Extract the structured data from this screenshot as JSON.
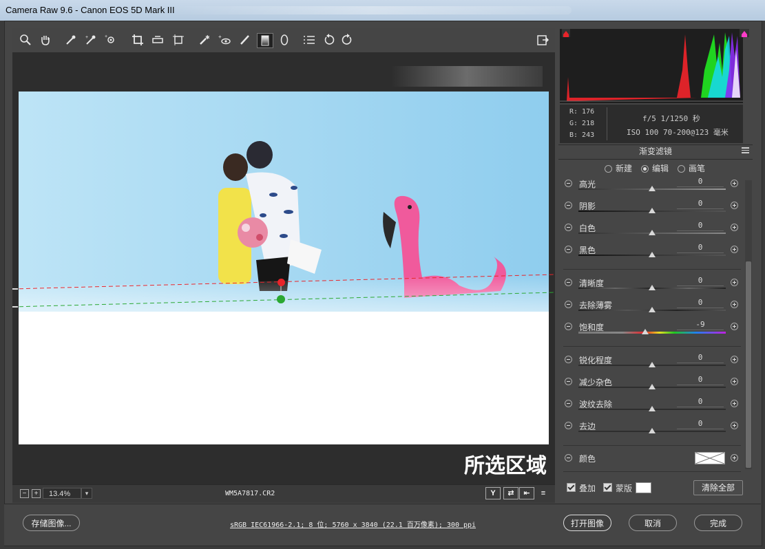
{
  "window": {
    "title": "Camera Raw 9.6 -  Canon EOS 5D Mark III"
  },
  "toolbar": {
    "tools": [
      "zoom-icon",
      "hand-icon",
      "white-balance-icon",
      "color-sampler-icon",
      "targeted-adjust-icon",
      "crop-icon",
      "straighten-icon",
      "transform-icon",
      "spot-removal-icon",
      "red-eye-icon",
      "adjustment-brush-icon",
      "graduated-filter-icon",
      "radial-filter-icon",
      "preferences-icon",
      "rotate-left-icon",
      "rotate-right-icon"
    ],
    "fullscreen": "fullscreen-icon"
  },
  "canvas": {
    "overlay_label": "所选区域",
    "zoom": "13.4%",
    "zoom_minus": "−",
    "zoom_plus": "+",
    "filename": "WM5A7817.CR2",
    "view_buttons": [
      "Y",
      "⇄",
      "⇤",
      "≡"
    ]
  },
  "info": {
    "r": "R:  176",
    "g": "G:  218",
    "b": "B:  243",
    "aperture_shutter": "f/5  1/1250 秒",
    "iso_lens": "ISO 100  70-200@123 毫米"
  },
  "panel": {
    "title": "渐变滤镜",
    "modes": [
      {
        "label": "新建",
        "selected": false
      },
      {
        "label": "编辑",
        "selected": true
      },
      {
        "label": "画笔",
        "selected": false
      }
    ],
    "sliders": [
      {
        "label": "高光",
        "value": "0",
        "pos": 0.5
      },
      {
        "label": "阴影",
        "value": "0",
        "pos": 0.5
      },
      {
        "label": "白色",
        "value": "0",
        "pos": 0.5
      },
      {
        "label": "黑色",
        "value": "0",
        "pos": 0.5
      },
      {
        "label": "清晰度",
        "value": "0",
        "pos": 0.5
      },
      {
        "label": "去除薄雾",
        "value": "0",
        "pos": 0.5
      },
      {
        "label": "饱和度",
        "value": "-9",
        "pos": 0.455
      },
      {
        "label": "锐化程度",
        "value": "0",
        "pos": 0.5
      },
      {
        "label": "减少杂色",
        "value": "0",
        "pos": 0.5
      },
      {
        "label": "波纹去除",
        "value": "0",
        "pos": 0.5
      },
      {
        "label": "去边",
        "value": "0",
        "pos": 0.5
      }
    ],
    "color_label": "颜色",
    "overlay_label": "叠加",
    "mask_label": "蒙版",
    "clear_all": "清除全部"
  },
  "footer": {
    "save": "存储图像...",
    "workflow": "sRGB IEC61966-2.1; 8 位; 5760 x 3840 (22.1 百万像素); 300 ppi",
    "open": "打开图像",
    "cancel": "取消",
    "done": "完成"
  },
  "colors": {
    "guide_red": "#e8242a",
    "guide_green": "#2aa832",
    "sky": "#a9d9f2"
  }
}
